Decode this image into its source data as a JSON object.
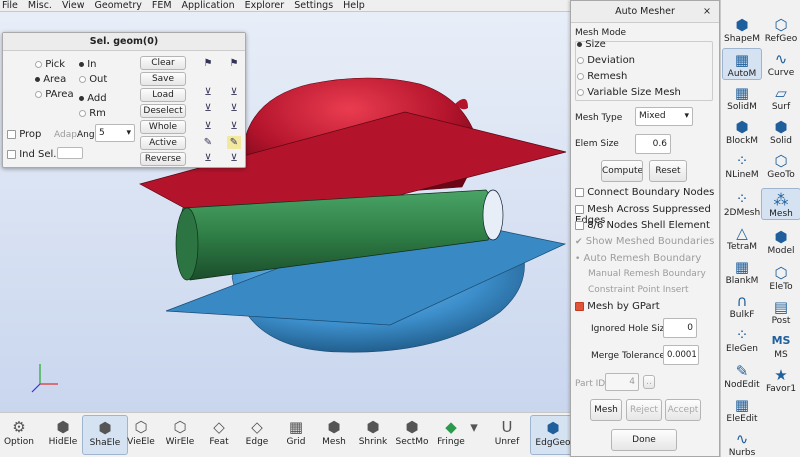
{
  "menu": [
    "File",
    "Misc.",
    "View",
    "Geometry",
    "FEM",
    "Application",
    "Explorer",
    "Settings",
    "Help"
  ],
  "sel_panel": {
    "title": "Sel. geom(0)",
    "modes": [
      "Pick",
      "Area",
      "PArea"
    ],
    "inout": [
      "In",
      "Out"
    ],
    "addrm": [
      "Add",
      "Rm"
    ],
    "buttons": [
      "Clear",
      "Save",
      "Load",
      "Deselect",
      "Whole",
      "Active",
      "Reverse"
    ],
    "prop_label": "Prop",
    "adap_label": "Adap",
    "ang_label": "Ang",
    "ang_value": "5",
    "ind_label": "Ind Sel. ID"
  },
  "auto_mesher": {
    "title": "Auto Mesher",
    "mode_label": "Mesh Mode",
    "modes": [
      "Size",
      "Deviation",
      "Remesh",
      "Variable Size Mesh"
    ],
    "mesh_type_label": "Mesh Type",
    "mesh_type_value": "Mixed",
    "elem_size_label": "Elem Size",
    "elem_size_value": "0.6",
    "compute_label": "Compute",
    "reset_label": "Reset",
    "connect_boundary": "Connect Boundary Nodes",
    "mesh_across": "Mesh Across Suppressed Edges",
    "nodes_shell": "8/6 Nodes Shell Element",
    "show_meshed": "Show Meshed Boundaries",
    "auto_remesh": "Auto Remesh Boundary",
    "manual_remesh": "Manual Remesh Boundary",
    "constraint_point": "Constraint Point Insert",
    "mesh_by_gpart": "Mesh by GPart",
    "ignored_hole_label": "Ignored Hole Size",
    "ignored_hole_value": "0",
    "merge_tol_label": "Merge Tolerance",
    "merge_tol_value": "0.0001",
    "part_id_label": "Part ID",
    "part_id_value": "4",
    "mesh_btn": "Mesh",
    "reject_btn": "Reject",
    "accept_btn": "Accept",
    "done_btn": "Done"
  },
  "bottom_tools": [
    "Option",
    "HidEle",
    "ShaEle",
    "VieEle",
    "WirEle",
    "Feat",
    "Edge",
    "Grid",
    "Mesh",
    "Shrink",
    "SectMo",
    "Fringe",
    "Unref",
    "EdgGeo"
  ],
  "right_tools": [
    "ShapeM",
    "RefGeo",
    "AutoM",
    "Curve",
    "SolidM",
    "Surf",
    "BlockM",
    "Solid",
    "NLineM",
    "GeoTo",
    "2DMesh",
    "Mesh",
    "TetraM",
    "Model",
    "BlankM",
    "EleTo",
    "BulkF",
    "Post",
    "EleGen",
    "MS",
    "NodEdit",
    "Favor1",
    "EleEdit",
    "Nurbs"
  ],
  "colors": {
    "red_part": "#b3142c",
    "green_part": "#2f7e46",
    "blue_part": "#3d8fcc",
    "highlight": "#e0543c"
  }
}
